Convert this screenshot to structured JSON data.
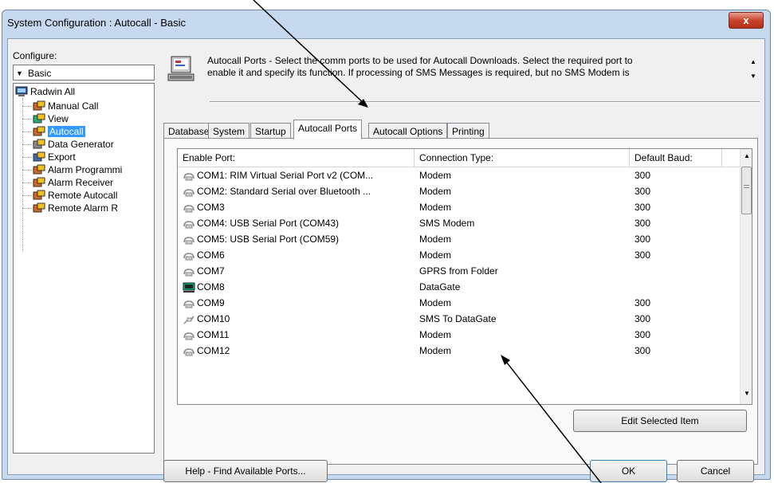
{
  "window": {
    "title": "System Configuration : Autocall - Basic",
    "close_glyph": "x"
  },
  "configure": {
    "label": "Configure:",
    "combo_value": "Basic"
  },
  "tree": {
    "root": "Radwin All",
    "items": [
      {
        "label": "Manual Call",
        "icon": "manual-call-icon"
      },
      {
        "label": "View",
        "icon": "view-icon"
      },
      {
        "label": "Autocall",
        "icon": "autocall-icon",
        "selected": true
      },
      {
        "label": "Data Generator",
        "icon": "data-generator-icon"
      },
      {
        "label": "Export",
        "icon": "export-icon"
      },
      {
        "label": "Alarm Programmi",
        "icon": "alarm-programming-icon"
      },
      {
        "label": "Alarm Receiver",
        "icon": "alarm-receiver-icon"
      },
      {
        "label": "Remote Autocall",
        "icon": "remote-autocall-icon"
      },
      {
        "label": "Remote Alarm R",
        "icon": "remote-alarm-icon"
      }
    ]
  },
  "info": {
    "line1": "Autocall Ports - Select the comm ports to be used for Autocall Downloads. Select the required port to",
    "line2": "enable it and specify its function. If processing of SMS Messages is required, but no SMS Modem is"
  },
  "tabs": [
    "Database",
    "System",
    "Startup",
    "Autocall Ports",
    "Autocall Options",
    "Printing"
  ],
  "active_tab": "Autocall Ports",
  "table": {
    "headers": [
      "Enable Port:",
      "Connection Type:",
      "Default Baud:"
    ],
    "rows": [
      {
        "port": "COM1: RIM Virtual Serial Port v2 (COM...",
        "type": "Modem",
        "baud": "300",
        "icon": "modem-port-icon"
      },
      {
        "port": "COM2: Standard Serial over Bluetooth ...",
        "type": "Modem",
        "baud": "300",
        "icon": "modem-port-icon"
      },
      {
        "port": "COM3",
        "type": "Modem",
        "baud": "300",
        "icon": "modem-port-icon"
      },
      {
        "port": "COM4: USB Serial Port (COM43)",
        "type": "SMS Modem",
        "baud": "300",
        "icon": "modem-port-icon"
      },
      {
        "port": "COM5: USB Serial Port (COM59)",
        "type": "Modem",
        "baud": "300",
        "icon": "modem-port-icon"
      },
      {
        "port": "COM6",
        "type": "Modem",
        "baud": "300",
        "icon": "modem-port-icon"
      },
      {
        "port": "COM7",
        "type": "GPRS from Folder",
        "baud": "",
        "icon": "modem-port-icon"
      },
      {
        "port": "COM8",
        "type": "DataGate",
        "baud": "",
        "icon": "computer-icon"
      },
      {
        "port": "COM9",
        "type": "Modem",
        "baud": "300",
        "icon": "modem-port-icon"
      },
      {
        "port": "COM10",
        "type": "SMS To DataGate",
        "baud": "300",
        "icon": "cable-port-icon"
      },
      {
        "port": "COM11",
        "type": "Modem",
        "baud": "300",
        "icon": "modem-port-icon"
      },
      {
        "port": "COM12",
        "type": "Modem",
        "baud": "300",
        "icon": "modem-port-icon"
      }
    ]
  },
  "buttons": {
    "edit_selected": "Edit Selected Item",
    "help_ports": "Help - Find Available Ports...",
    "ok": "OK",
    "cancel": "Cancel"
  }
}
